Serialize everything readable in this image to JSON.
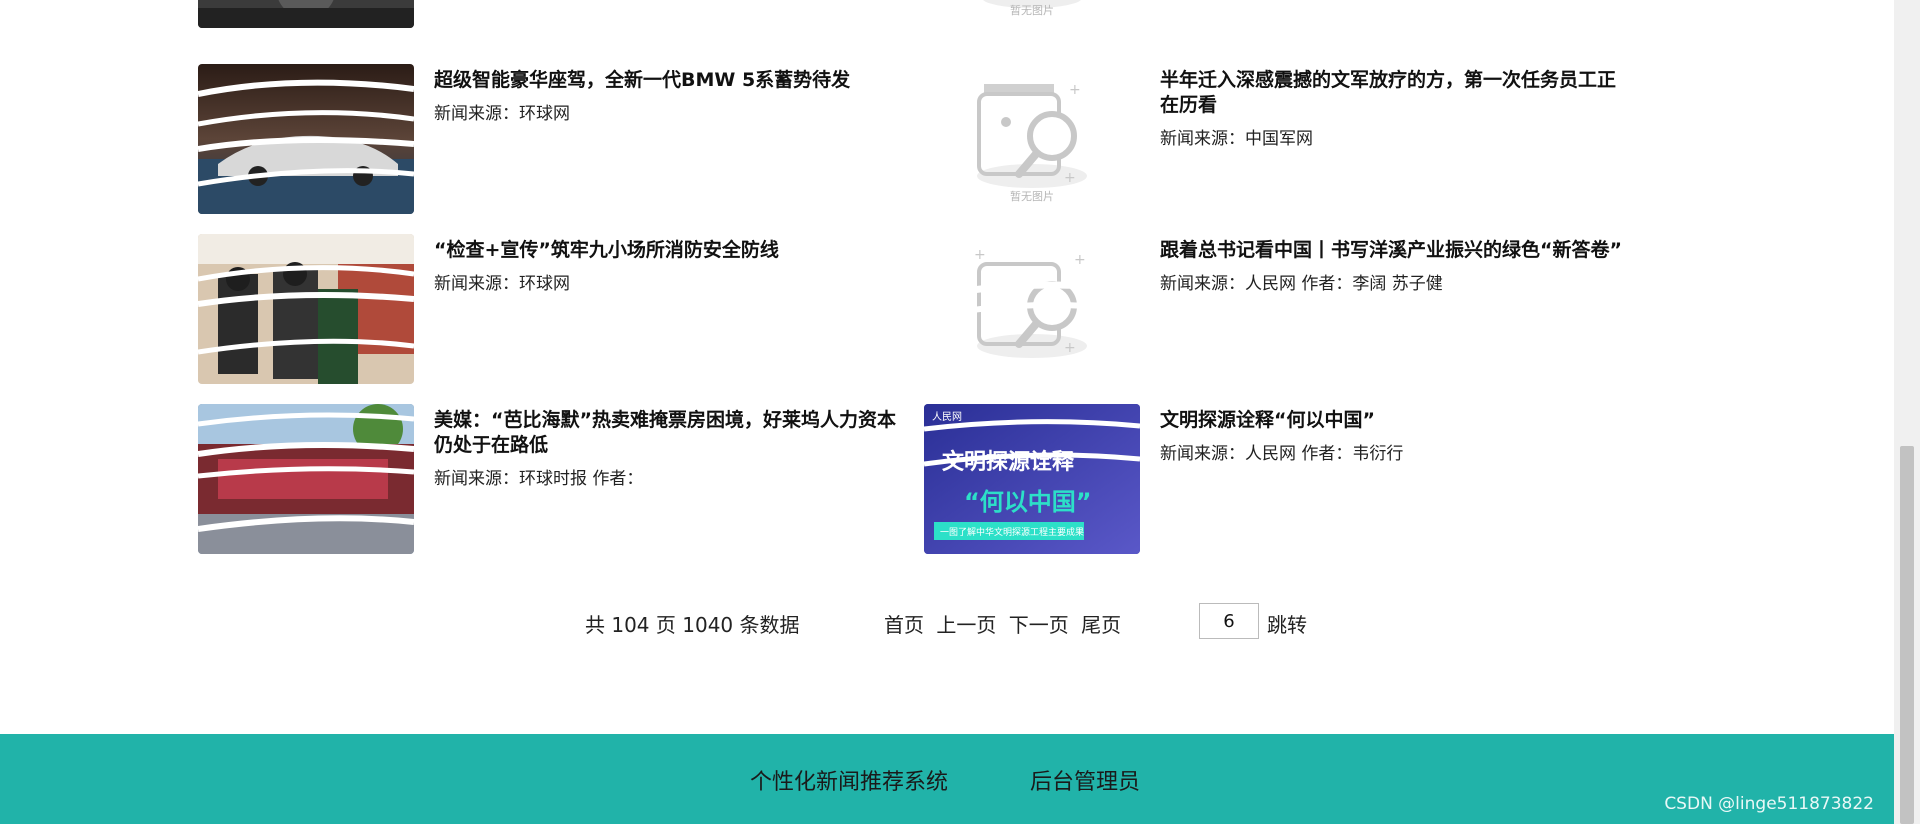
{
  "news": [
    {
      "title": "超级智能豪华座驾，全新一代BMW 5系蓄势待发",
      "source": "新闻来源：环球网",
      "has_image": true,
      "image_theme": "car"
    },
    {
      "title": "半年迁入深感震撼的文军放疗的方，第一次任务员工正在历看",
      "source": "新闻来源：中国军网",
      "has_image": false,
      "placeholder_caption": "暂无图片"
    },
    {
      "title": "“检查+宣传”筑牢九小场所消防安全防线",
      "source": "新闻来源：环球网",
      "has_image": true,
      "image_theme": "market"
    },
    {
      "title": "跟着总书记看中国丨书写洋溪产业振兴的绿色“新答卷”",
      "source": "新闻来源：人民网 作者：李阔 苏子健",
      "has_image": false,
      "placeholder_caption": ""
    },
    {
      "title": "美媒：“芭比海默”热卖难掩票房困境，好莱坞人力资本仍处于在路低",
      "source": "新闻来源：环球时报 作者：",
      "has_image": true,
      "image_theme": "cinema"
    },
    {
      "title": "文明探源诠释“何以中国”",
      "source": "新闻来源：人民网 作者：韦衍行",
      "has_image": true,
      "image_theme": "poster",
      "poster_line1": "文明探源诠释",
      "poster_line2": "“何以中国”",
      "poster_caption": "一图了解中华文明探源工程主要成果",
      "poster_logo": "人民网"
    }
  ],
  "top_partial_caption": "暂无图片",
  "pagination": {
    "total_text": "共 104 页 1040 条数据",
    "first": "首页",
    "prev": "上一页",
    "next": "下一页",
    "last": "尾页",
    "page_value": "6",
    "jump": "跳转"
  },
  "footer": {
    "system_link": "个性化新闻推荐系统",
    "admin_link": "后台管理员",
    "watermark": "CSDN @linge511873822"
  },
  "colors": {
    "footer_bg": "#21b3a9",
    "poster_bg": "#3a3fa8",
    "poster_accent": "#2ce0c8"
  }
}
